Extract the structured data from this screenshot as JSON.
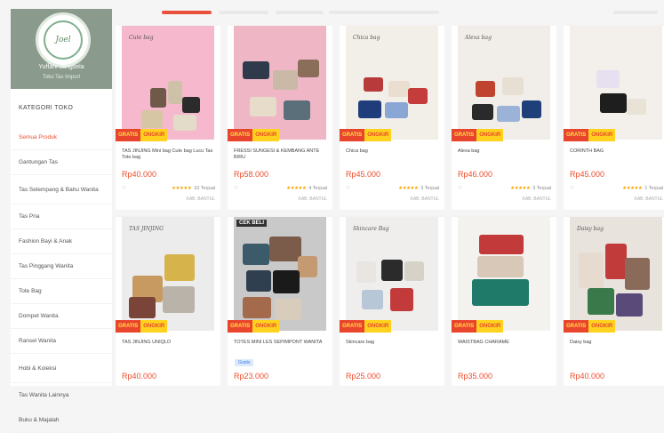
{
  "shop": {
    "logo_text": "Joel",
    "name": "Yuffani Jangsela",
    "sub": "Toko Tas Import"
  },
  "sidebar": {
    "title": "KATEGORI TOKO",
    "items": [
      {
        "label": "Semua Produk",
        "active": true
      },
      {
        "label": "Gantungan Tas"
      },
      {
        "label": "Tas Selempang & Bahu Wanita"
      },
      {
        "label": "Tas Pria"
      },
      {
        "label": "Fashion Bayi & Anak"
      },
      {
        "label": "Tas Pinggang Wanita"
      },
      {
        "label": "Tote Bag"
      },
      {
        "label": "Dompet Wanita"
      },
      {
        "label": "Ransel Wanita"
      },
      {
        "label": "Hobi & Koleksi"
      },
      {
        "label": "Tas Wanita Lainnya"
      },
      {
        "label": "Buku & Majalah"
      }
    ]
  },
  "promo": {
    "a": "GRATIS",
    "b": "ONGKIR"
  },
  "products": [
    {
      "label": "Cute bag",
      "badge": "",
      "name": "TAS JINJING Mini bag Cute bag Lucu Tas Tote bag",
      "price": "Rp40.000",
      "rating": "★★★★★",
      "sold": "10 Terjual",
      "location": "KAB. BANTUL",
      "tag": "",
      "bg": "#f5b8cd"
    },
    {
      "label": "",
      "badge": "",
      "name": "FRESSI SUNGESI & KEMBANG ANTE BIRU",
      "price": "Rp58.000",
      "rating": "★★★★★",
      "sold": "4 Terjual",
      "location": "KAB. BANTUL",
      "tag": "",
      "bg": "#efb7c6"
    },
    {
      "label": "Chica bag",
      "badge": "",
      "name": "Chica bag",
      "price": "Rp45.000",
      "rating": "★★★★★",
      "sold": "3 Terjual",
      "location": "KAB. BANTUL",
      "tag": "",
      "bg": "#f2efe8"
    },
    {
      "label": "Alexa bag",
      "badge": "",
      "name": "Alexa bag",
      "price": "Rp46.000",
      "rating": "★★★★★",
      "sold": "3 Terjual",
      "location": "KAB. BANTUL",
      "tag": "",
      "bg": "#f1eee9"
    },
    {
      "label": "",
      "badge": "",
      "name": "CORINTH BAG",
      "price": "Rp45.000",
      "rating": "★★★★★",
      "sold": "1 Terjual",
      "location": "KAB. BANTUL",
      "tag": "",
      "bg": "#f3f0ec"
    },
    {
      "label": "TAS JINJING",
      "badge": "",
      "name": "TAS JINJING UNIQLO",
      "price": "Rp40.000",
      "rating": "",
      "sold": "",
      "location": "",
      "tag": "",
      "bg": "#ececec"
    },
    {
      "label": "",
      "badge": "CEK BELI",
      "name": "TOTES MINI LES SEPIMPONT WANITA",
      "price": "Rp23.000",
      "rating": "",
      "sold": "",
      "location": "",
      "tag": "Gratis",
      "bg": "#c9c9c9"
    },
    {
      "label": "Skincare Bag",
      "badge": "",
      "name": "Skincare bag",
      "price": "Rp25.000",
      "rating": "",
      "sold": "",
      "location": "",
      "tag": "",
      "bg": "#efeeed"
    },
    {
      "label": "",
      "badge": "",
      "name": "WAISTBAG CHARAME",
      "price": "Rp35.000",
      "rating": "",
      "sold": "",
      "location": "",
      "tag": "",
      "bg": "#f4f2ef"
    },
    {
      "label": "Daisy bag",
      "badge": "",
      "name": "Daisy bag",
      "price": "Rp40.000",
      "rating": "",
      "sold": "",
      "location": "",
      "tag": "",
      "bg": "#e9e3de"
    }
  ]
}
